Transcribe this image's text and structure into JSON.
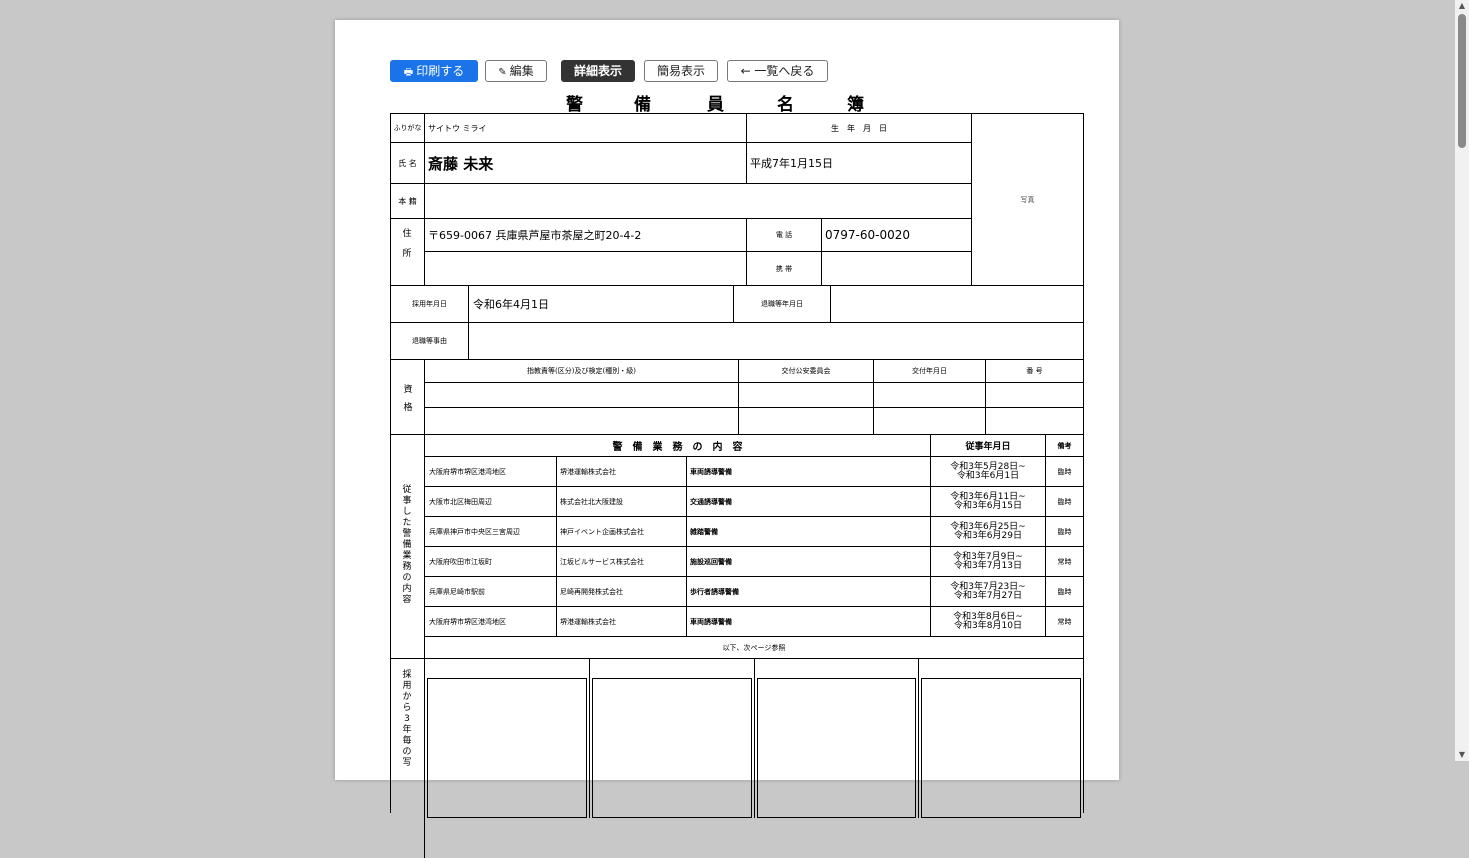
{
  "toolbar": {
    "print": "印刷する",
    "print_icon": "🖶",
    "edit": "編集",
    "edit_icon": "✎",
    "detail": "詳細表示",
    "simple": "簡易表示",
    "back": "← 一覧へ戻る"
  },
  "title_chars": [
    "警",
    "備",
    "員",
    "名",
    "簿"
  ],
  "labels": {
    "furigana": "ふりがな",
    "name": "氏 名",
    "honseki": "本 籍",
    "address_1": "住",
    "address_2": "所",
    "birthdate": "生　年　月　日",
    "photo": "写真",
    "phone": "電 話",
    "mobile": "携 帯",
    "hire_date": "採用年月日",
    "retire_date": "退職等年月日",
    "retire_reason": "退職等事由",
    "qual": "資格",
    "qual_col1": "指教責等(区分)及び検定(種別・級)",
    "qual_col2": "交付公安委員会",
    "qual_col3": "交付年月日",
    "qual_col4": "番 号",
    "duties_side": "従事した警備業務の内容",
    "duties_header": "警　備　業　務　の　内　容",
    "duties_date": "従事年月日",
    "duties_note": "備考",
    "duties_footer": "以下、次ページ参照",
    "photos_side": "採用から3年毎の写"
  },
  "person": {
    "furigana": "サイトウ ミライ",
    "name": "斎藤 未来",
    "birthdate": "平成7年1月15日",
    "address": "〒659-0067  兵庫県芦屋市茶屋之町20-4-2",
    "phone": "0797-60-0020",
    "hire_date": "令和6年4月1日"
  },
  "duties": [
    {
      "place": "大阪府堺市堺区港湾地区",
      "company": "堺港運輸株式会社",
      "task": "車両誘導警備",
      "from": "令和3年5月28日~",
      "to": "令和3年6月1日",
      "note": "臨時"
    },
    {
      "place": "大阪市北区梅田周辺",
      "company": "株式会社北大阪建設",
      "task": "交通誘導警備",
      "from": "令和3年6月11日~",
      "to": "令和3年6月15日",
      "note": "臨時"
    },
    {
      "place": "兵庫県神戸市中央区三宮周辺",
      "company": "神戸イベント企画株式会社",
      "task": "雑踏警備",
      "from": "令和3年6月25日~",
      "to": "令和3年6月29日",
      "note": "臨時"
    },
    {
      "place": "大阪府吹田市江坂町",
      "company": "江坂ビルサービス株式会社",
      "task": "施設巡回警備",
      "from": "令和3年7月9日~",
      "to": "令和3年7月13日",
      "note": "常時"
    },
    {
      "place": "兵庫県尼崎市駅前",
      "company": "尼崎再開発株式会社",
      "task": "歩行者誘導警備",
      "from": "令和3年7月23日~",
      "to": "令和3年7月27日",
      "note": "臨時"
    },
    {
      "place": "大阪府堺市堺区港湾地区",
      "company": "堺港運輸株式会社",
      "task": "車両誘導警備",
      "from": "令和3年8月6日~",
      "to": "令和3年8月10日",
      "note": "常時"
    }
  ],
  "scrollbar": {
    "up": "▲",
    "down": "▼"
  }
}
